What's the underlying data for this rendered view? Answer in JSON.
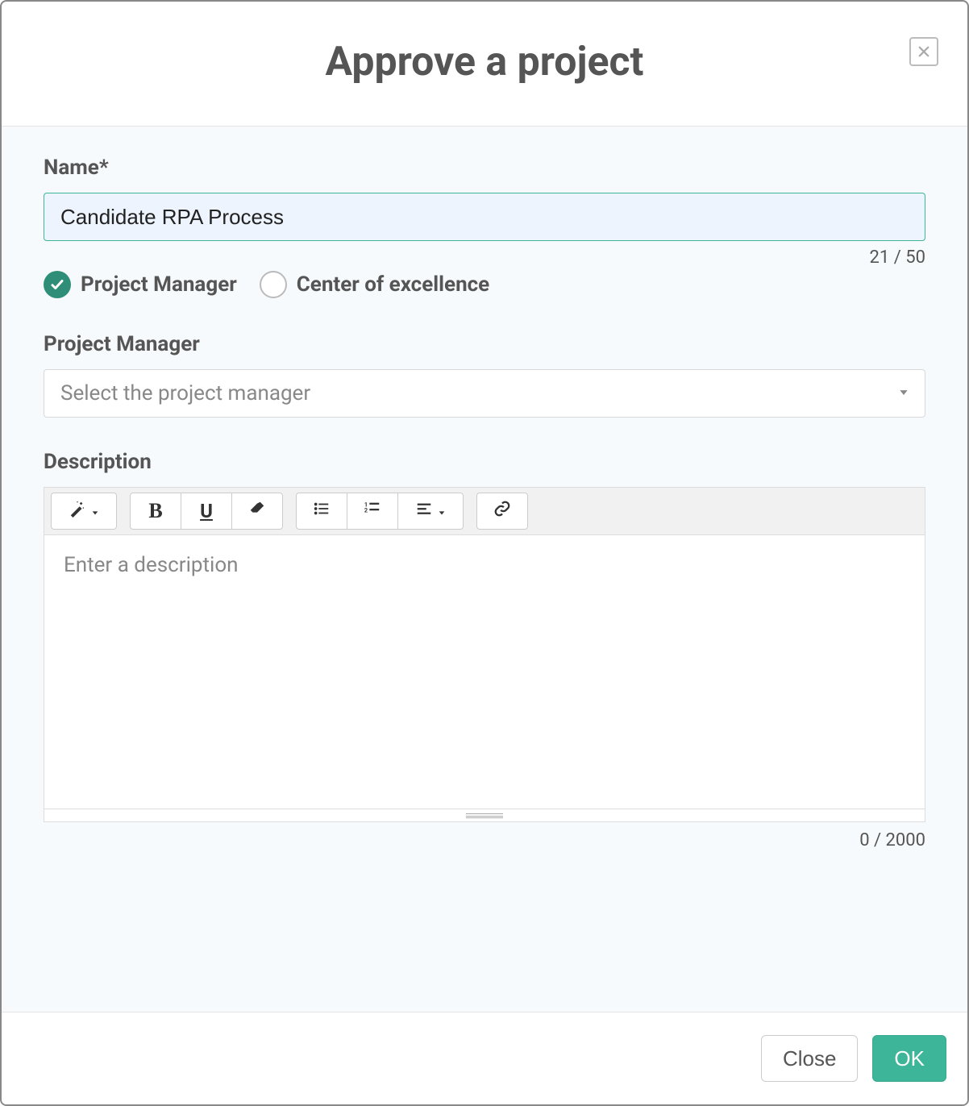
{
  "modal": {
    "title": "Approve a project"
  },
  "name": {
    "label": "Name*",
    "value": "Candidate RPA Process",
    "counter": "21 / 50"
  },
  "roleOptions": {
    "option1": "Project Manager",
    "option2": "Center of excellence"
  },
  "projectManager": {
    "label": "Project Manager",
    "placeholder": "Select the project manager"
  },
  "description": {
    "label": "Description",
    "placeholder": "Enter a description",
    "counter": "0 / 2000"
  },
  "footer": {
    "close": "Close",
    "ok": "OK"
  }
}
